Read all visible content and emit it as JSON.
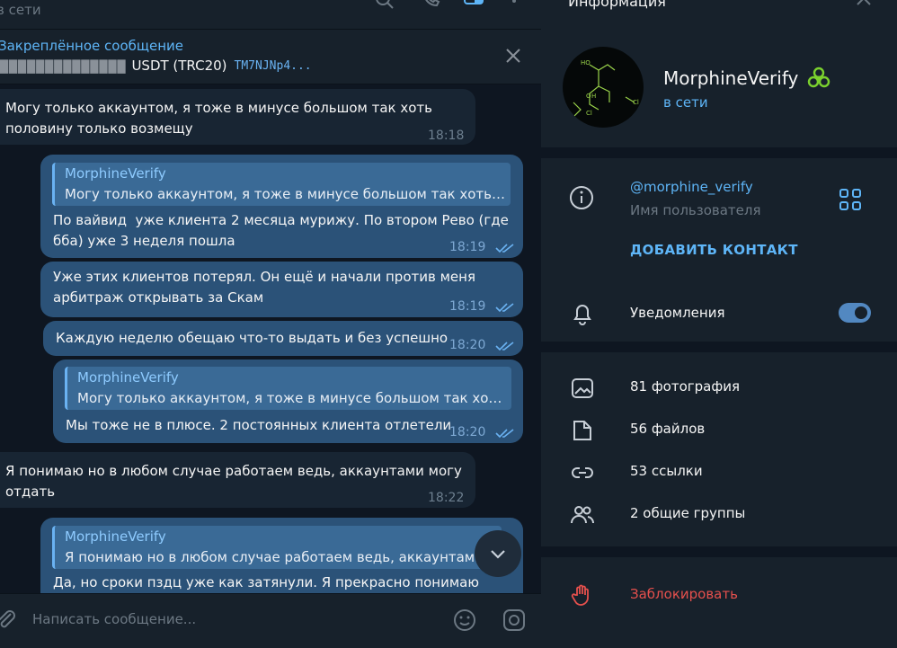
{
  "chat": {
    "header_status": "в сети",
    "pinned": {
      "title": "Закреплённое сообщение",
      "garbled": "▇▇▇▇▇▇▇▇▇▇▇▇▇▇",
      "body": "USDT (TRC20)",
      "address": "TM7NJNp4..."
    },
    "messages": [
      {
        "dir": "in",
        "text": "Могу только аккаунтом, я тоже в минусе большом так хоть\nполовину только возмещу",
        "time": "18:18"
      },
      {
        "dir": "out",
        "reply_name": "MorphineVerify",
        "reply_text": "Могу только аккаунтом, я тоже в минусе большом так хоть п...",
        "text": "По вайвид  уже клиента 2 месяца мурижу. По втором Рево (где\nбба) уже 3 неделя пошла",
        "time": "18:19"
      },
      {
        "dir": "out",
        "text": "Уже этих клиентов потерял. Он ещё и начали против меня\nарбитраж открывать за Скам",
        "time": "18:19"
      },
      {
        "dir": "out",
        "text": "Каждую неделю обещаю что-то выдать и без успешно",
        "time": "18:20"
      },
      {
        "dir": "out",
        "reply_name": "MorphineVerify",
        "reply_text": "Могу только аккаунтом, я тоже в минусе большом так хоть ...",
        "text": "Мы тоже не в плюсе. 2 постоянных клиента отлетели",
        "time": "18:20"
      },
      {
        "dir": "in",
        "text": "Я понимаю но в любом случае работаем ведь, аккаунтами могу\nотдать",
        "time": "18:22"
      },
      {
        "dir": "out",
        "reply_name": "MorphineVerify",
        "reply_text": "Я понимаю но в любом случае работаем ведь, аккаунтами",
        "text": "Да, но сроки пздц уже как затянули. Я прекрасно понимаю",
        "time": ""
      }
    ],
    "composer_placeholder": "Написать сообщение..."
  },
  "info": {
    "title": "Информация",
    "name": "MorphineVerify",
    "status": "в сети",
    "username": "@morphine_verify",
    "username_caption": "Имя пользователя",
    "add_contact": "ДОБАВИТЬ КОНТАКТ",
    "notifications": "Уведомления",
    "notifications_on": true,
    "media": [
      {
        "icon": "photo-icon",
        "label": "81 фотография"
      },
      {
        "icon": "file-icon",
        "label": "56 файлов"
      },
      {
        "icon": "link-icon",
        "label": "53 ссылки"
      },
      {
        "icon": "groups-icon",
        "label": "2 общие группы"
      }
    ],
    "block": "Заблокировать"
  },
  "colors": {
    "bg": "#0e1621",
    "panel": "#17212b",
    "bubble_in": "#182533",
    "bubble_out": "#2b5278",
    "accent": "#5eb5f7",
    "danger": "#e5504d"
  }
}
